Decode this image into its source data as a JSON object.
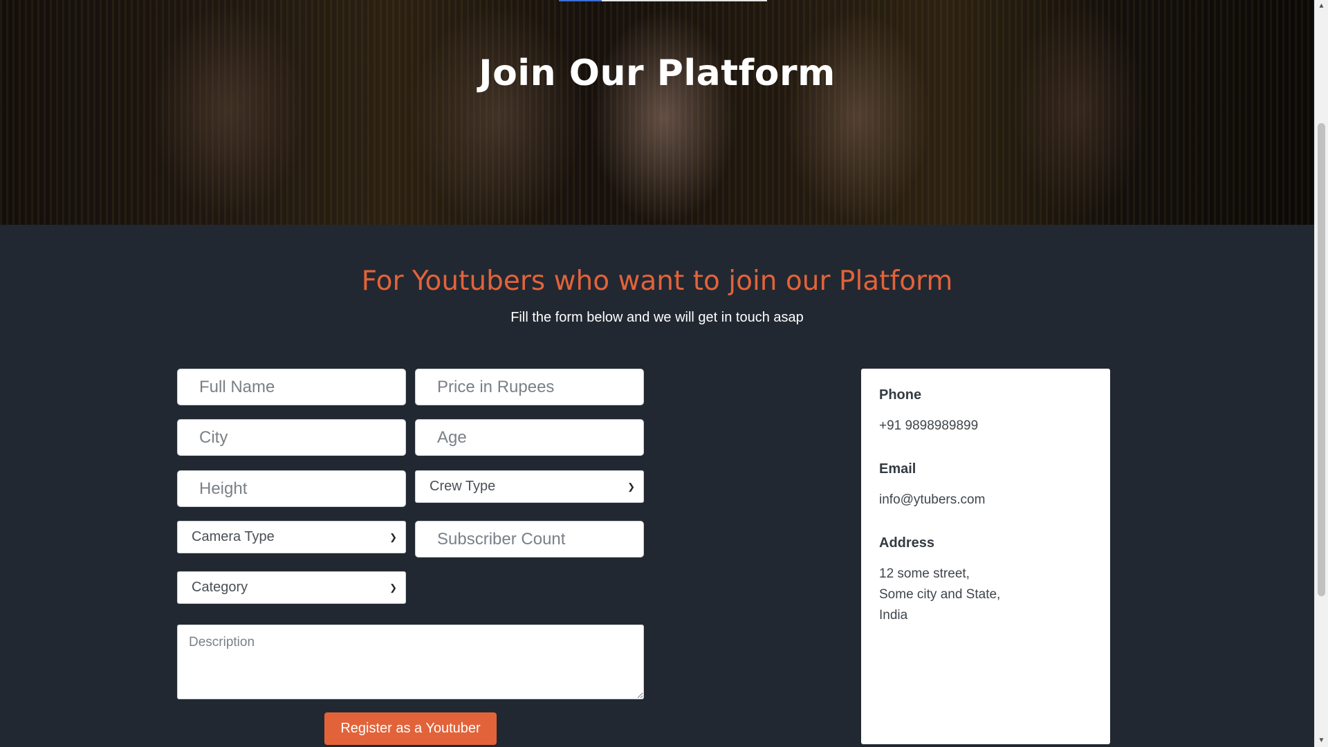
{
  "hero": {
    "title": "Join Our Platform"
  },
  "section": {
    "title": "For Youtubers who want to join our Platform",
    "subtitle": "Fill the form below and we will get in touch asap"
  },
  "form": {
    "full_name": {
      "placeholder": "Full Name"
    },
    "price": {
      "placeholder": "Price in Rupees"
    },
    "city": {
      "placeholder": "City"
    },
    "age": {
      "placeholder": "Age"
    },
    "height": {
      "placeholder": "Height"
    },
    "crew_type": {
      "selected": "Crew Type"
    },
    "camera_type": {
      "selected": "Camera Type"
    },
    "subscriber_count": {
      "placeholder": "Subscriber Count"
    },
    "category": {
      "selected": "Category"
    },
    "description": {
      "placeholder": "Description"
    },
    "submit_label": "Register as a Youtuber"
  },
  "contact": {
    "phone_label": "Phone",
    "phone_value": "+91 9898989899",
    "email_label": "Email",
    "email_value": "info@ytubers.com",
    "address_label": "Address",
    "address_line1": "12 some street,",
    "address_line2": "Some city and State,",
    "address_line3": "India"
  },
  "icons": {
    "select_chevron": "chevron-down-icon",
    "scroll_up": "scroll-up-arrow-icon",
    "scroll_down": "scroll-down-arrow-icon"
  },
  "colors": {
    "background": "#222831",
    "accent": "#e2633a",
    "nav_active": "#3b6fd6"
  }
}
